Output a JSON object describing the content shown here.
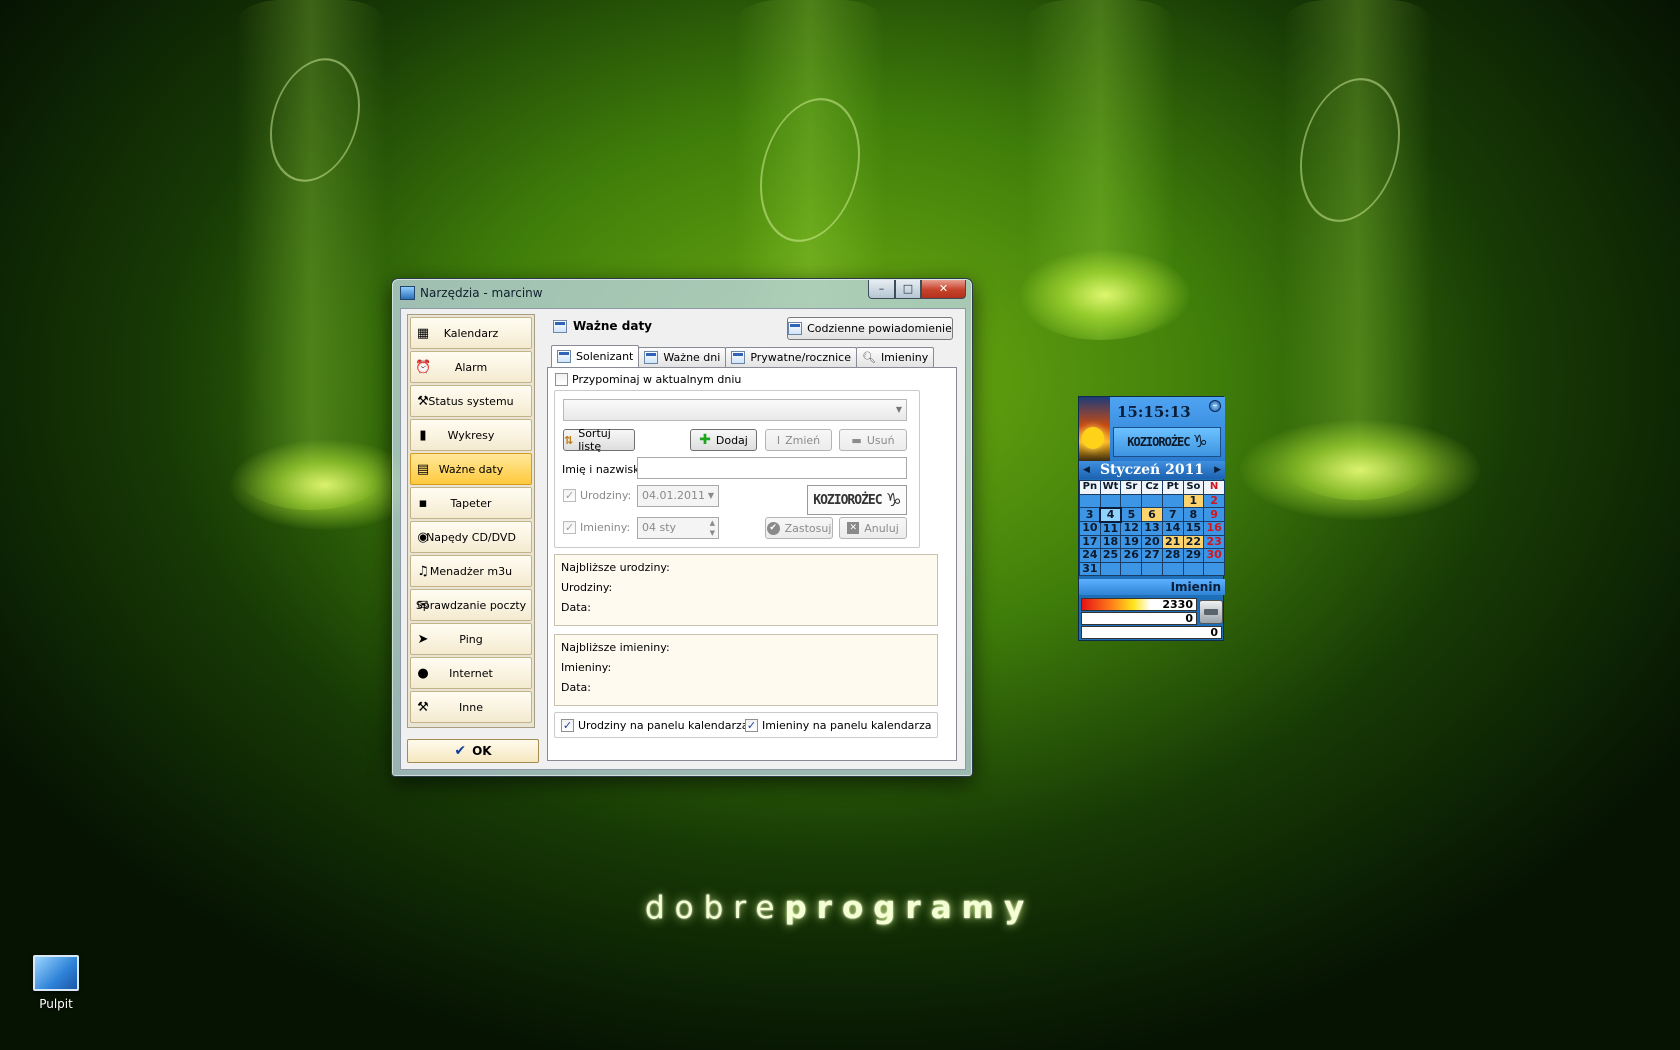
{
  "window": {
    "title": "Narzędzia - marcinw",
    "controls": {
      "minimize": "–",
      "maximize": "□",
      "close": "✕"
    }
  },
  "sidebar": {
    "items": [
      {
        "label": "Kalendarz",
        "icon": "calendar-icon",
        "glyph": "▦"
      },
      {
        "label": "Alarm",
        "icon": "alarm-clock-icon",
        "glyph": "⏰"
      },
      {
        "label": "Status systemu",
        "icon": "tools-icon",
        "glyph": "⚒"
      },
      {
        "label": "Wykresy",
        "icon": "chart-icon",
        "glyph": "▮"
      },
      {
        "label": "Ważne daty",
        "icon": "calendar-page-icon",
        "glyph": "▤"
      },
      {
        "label": "Tapeter",
        "icon": "monitor-icon",
        "glyph": "▪"
      },
      {
        "label": "Napędy CD/DVD",
        "icon": "disc-icon",
        "glyph": "◉"
      },
      {
        "label": "Menadżer m3u",
        "icon": "playlist-icon",
        "glyph": "♫"
      },
      {
        "label": "Sprawdzanie poczty",
        "icon": "mail-icon",
        "glyph": "✉"
      },
      {
        "label": "Ping",
        "icon": "ping-icon",
        "glyph": "➤"
      },
      {
        "label": "Internet",
        "icon": "globe-icon",
        "glyph": "●"
      },
      {
        "label": "Inne",
        "icon": "hammer-icon",
        "glyph": "⚒"
      }
    ],
    "active_index": 4,
    "ok_label": "OK"
  },
  "panel": {
    "title": "Ważne daty",
    "notifications_button": "Codzienne powiadomienie",
    "tabs": [
      {
        "label": "Solenizant",
        "icon": "calendar-icon"
      },
      {
        "label": "Ważne dni",
        "icon": "calendar-icon"
      },
      {
        "label": "Prywatne/rocznice",
        "icon": "calendar-icon"
      },
      {
        "label": "Imieniny",
        "icon": "search-icon"
      }
    ],
    "active_tab": 0,
    "remind_label": "Przypominaj w aktualnym dniu",
    "combo_value": "",
    "sort_button": "Sortuj listę",
    "add_button": "Dodaj",
    "change_button": "Zmień",
    "delete_button": "Usuń",
    "name_label": "Imię i nazwisko:",
    "name_value": "",
    "birthday_label": "Urodziny:",
    "birthday_value": "04.01.2011",
    "nameday_label": "Imieniny:",
    "nameday_value": "04 sty",
    "zodiac_label": "KOZIOROŻEC",
    "apply_button": "Zastosuj",
    "cancel_button": "Anuluj",
    "next_birthdays": {
      "heading": "Najbliższe urodziny:",
      "line1": "Urodziny:",
      "line2": "Data:"
    },
    "next_namedays": {
      "heading": "Najbliższe imieniny:",
      "line1": "Imieniny:",
      "line2": "Data:"
    },
    "birthdays_on_panel": "Urodziny na panelu kalendarza",
    "namedays_on_panel": "Imieniny na panelu kalendarza"
  },
  "gadget": {
    "time": "15:15:13",
    "zodiac": "KOZIOROŻEC",
    "month": "Styczeń 2011",
    "weekdays": [
      "Pn",
      "Wt",
      "Śr",
      "Cz",
      "Pt",
      "So",
      "N"
    ],
    "weeks": [
      [
        "",
        "",
        "",
        "",
        "",
        "1",
        "2"
      ],
      [
        "3",
        "4",
        "5",
        "6",
        "7",
        "8",
        "9"
      ],
      [
        "10",
        "11",
        "12",
        "13",
        "14",
        "15",
        "16"
      ],
      [
        "17",
        "18",
        "19",
        "20",
        "21",
        "22",
        "23"
      ],
      [
        "24",
        "25",
        "26",
        "27",
        "28",
        "29",
        "30"
      ],
      [
        "31",
        "",
        "",
        "",
        "",
        "",
        ""
      ]
    ],
    "today": "4",
    "highlighted": [
      "1",
      "6",
      "21",
      "22"
    ],
    "names_label": "Imienin",
    "counter1": "2330",
    "counter2": "0",
    "counter3": "0"
  },
  "desktop": {
    "brand_light": "dobre",
    "brand_bold": "programy",
    "icon_label": "Pulpit"
  }
}
